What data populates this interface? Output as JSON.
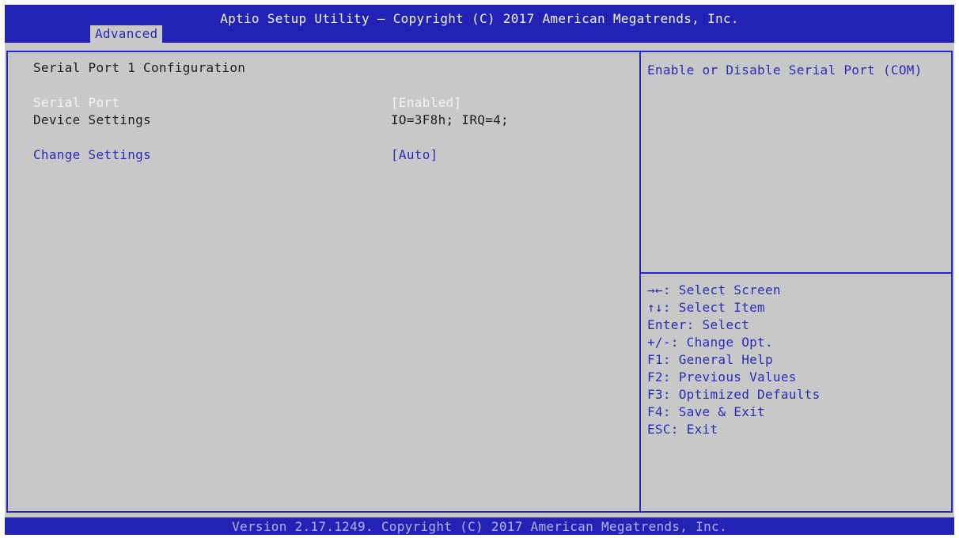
{
  "header": {
    "title": "Aptio Setup Utility – Copyright (C) 2017 American Megatrends, Inc.",
    "active_tab": "Advanced"
  },
  "main": {
    "section_title": "Serial Port 1 Configuration",
    "rows": [
      {
        "label": "Serial Port",
        "value": "[Enabled]"
      },
      {
        "label": "Device Settings",
        "value": "IO=3F8h; IRQ=4;"
      },
      {
        "label": "Change Settings",
        "value": "[Auto]"
      }
    ]
  },
  "help": {
    "text": "Enable or Disable Serial Port (COM)"
  },
  "keys": [
    "→←: Select Screen",
    "↑↓: Select Item",
    "Enter: Select",
    "+/-: Change Opt.",
    "F1: General Help",
    "F2: Previous Values",
    "F3: Optimized Defaults",
    "F4: Save & Exit",
    "ESC: Exit"
  ],
  "footer": {
    "text": "Version 2.17.1249. Copyright (C) 2017 American Megatrends, Inc."
  },
  "colors": {
    "header_bg": "#2222b4",
    "panel_bg": "#c8c8c8",
    "accent_blue": "#2a2ab8",
    "selected_text": "#f4f4f4"
  }
}
